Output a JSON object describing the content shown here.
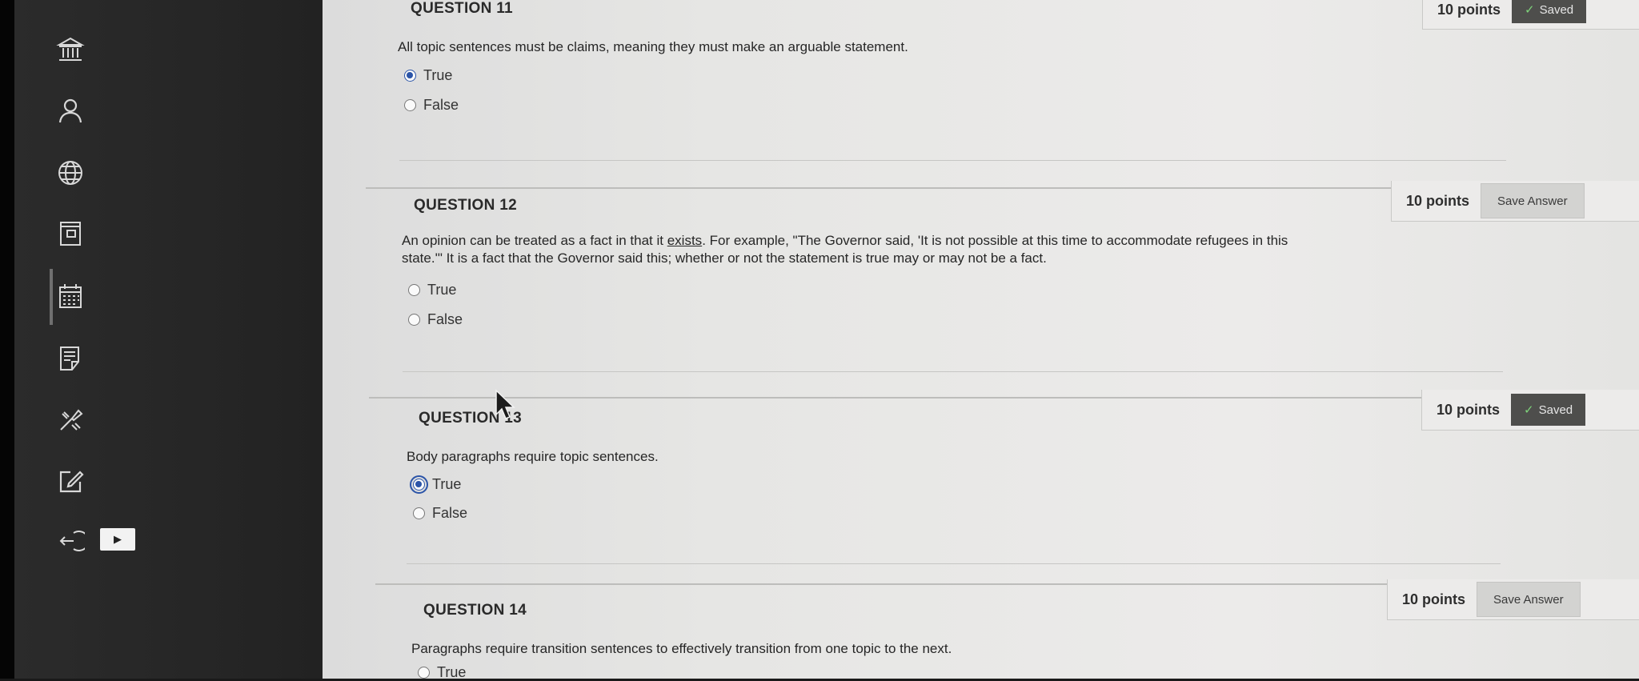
{
  "questions": [
    {
      "title": "QUESTION 11",
      "text": "All topic sentences must be claims, meaning they must make an arguable statement.",
      "points": "10 points",
      "status": "Saved",
      "options": [
        {
          "label": "True",
          "selected": true
        },
        {
          "label": "False",
          "selected": false
        }
      ]
    },
    {
      "title": "QUESTION 12",
      "text_part1": "An opinion can be treated as a fact in that it ",
      "text_link": "exists",
      "text_part2": ". For example, \"The Governor said, 'It is not possible at this time to accommodate refugees in this state.'\" It is a fact that the Governor said this; whether or not the statement is true may or may not be a fact.",
      "points": "10 points",
      "button": "Save Answer",
      "options": [
        {
          "label": "True",
          "selected": false
        },
        {
          "label": "False",
          "selected": false
        }
      ]
    },
    {
      "title": "QUESTION 13",
      "text": "Body paragraphs require topic sentences.",
      "points": "10 points",
      "status": "Saved",
      "options": [
        {
          "label": "True",
          "selected": true
        },
        {
          "label": "False",
          "selected": false
        }
      ]
    },
    {
      "title": "QUESTION 14",
      "text": "Paragraphs require transition sentences to effectively transition from one topic to the next.",
      "points": "10 points",
      "button": "Save Answer",
      "options": [
        {
          "label": "True",
          "selected": false
        }
      ]
    }
  ],
  "icons": [
    "institution-icon",
    "user-icon",
    "globe-icon",
    "courses-icon",
    "calendar-icon",
    "grades-icon",
    "tools-icon",
    "edit-icon",
    "logout-icon"
  ]
}
